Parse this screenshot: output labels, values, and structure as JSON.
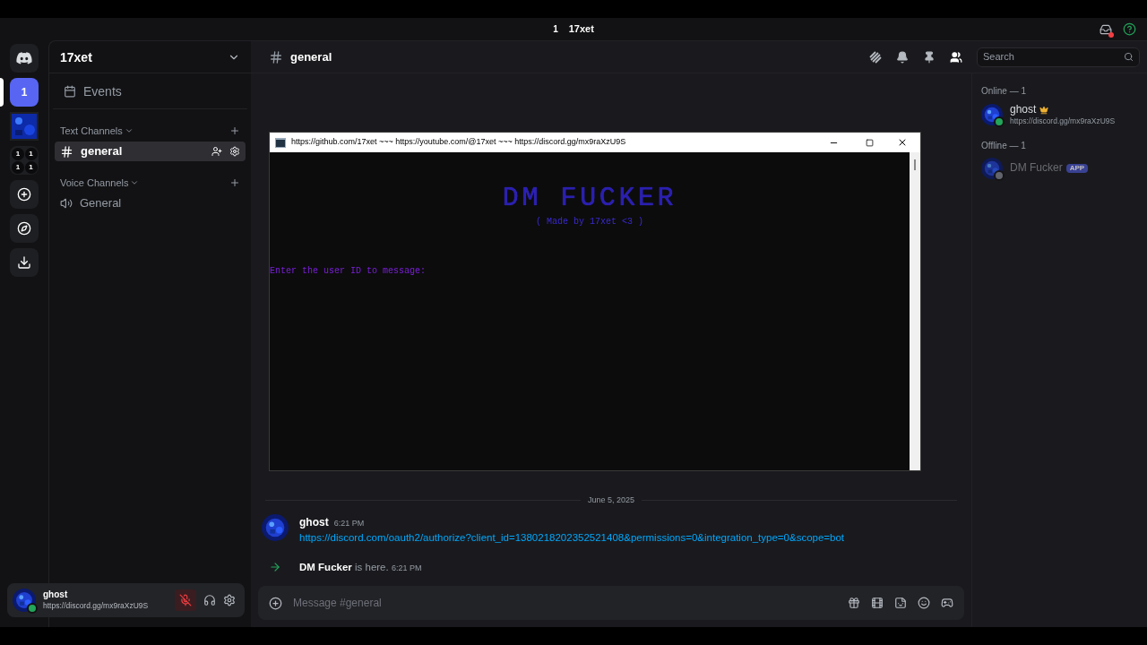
{
  "top_bar": {
    "badge": "1",
    "title": "17xet"
  },
  "servers": [
    {
      "kind": "home",
      "selected": false
    },
    {
      "kind": "text",
      "label": "1",
      "selected": true
    },
    {
      "kind": "avatar",
      "selected": false
    },
    {
      "kind": "folder",
      "labels": [
        "1",
        "1",
        "1",
        "1"
      ],
      "selected": false
    },
    {
      "kind": "add",
      "selected": false
    },
    {
      "kind": "discover",
      "selected": false
    },
    {
      "kind": "download",
      "selected": false
    }
  ],
  "server": {
    "name": "17xet"
  },
  "events": "Events",
  "categories": [
    {
      "name": "Text Channels",
      "channels": [
        {
          "kind": "text",
          "name": "general",
          "selected": true
        }
      ]
    },
    {
      "name": "Voice Channels",
      "channels": [
        {
          "kind": "voice",
          "name": "General",
          "selected": false
        }
      ]
    }
  ],
  "user_panel": {
    "name": "ghost",
    "status": "https://discord.gg/mx9raXzU9S",
    "online": true,
    "muted": true
  },
  "channel_header": {
    "name": "general"
  },
  "search": {
    "placeholder": "Search"
  },
  "console": {
    "title": "https://github.com/17xet ~~~ https://youtube.com/@17xet ~~~ https://discord.gg/mx9raXzU9S",
    "banner": "DM FUCKER",
    "subtitle": "( Made by 17xet <3 )",
    "prompt": "Enter the user ID to message:"
  },
  "divider_date": "June 5, 2025",
  "messages": [
    {
      "kind": "message",
      "author": "ghost",
      "time": "6:21 PM",
      "text": "https://discord.com/oauth2/authorize?client_id=1380218202352521408&permissions=0&integration_type=0&scope=bot"
    },
    {
      "kind": "join",
      "author": "DM Fucker",
      "text": "is here.",
      "time": "6:21 PM"
    }
  ],
  "composer": {
    "placeholder": "Message #general"
  },
  "members": [
    {
      "heading": "Online — 1",
      "items": [
        {
          "name": "ghost",
          "status": "https://discord.gg/mx9raXzU9S",
          "online": true,
          "owner": true
        }
      ]
    },
    {
      "heading": "Offline — 1",
      "items": [
        {
          "name": "DM Fucker",
          "badge": "APP",
          "online": false,
          "owner": false
        }
      ]
    }
  ]
}
